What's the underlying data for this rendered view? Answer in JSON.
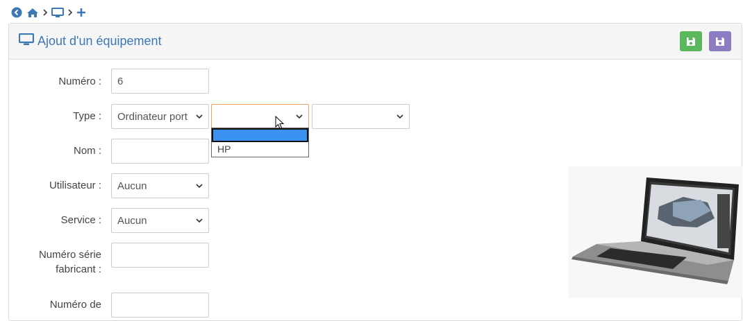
{
  "breadcrumb": {
    "items": [
      "back-icon",
      "home-icon",
      "monitor-icon",
      "plus-icon"
    ]
  },
  "panel": {
    "title": "Ajout d'un équipement",
    "icon": "monitor-icon"
  },
  "actions": {
    "save_icon": "save-icon",
    "save_close_icon": "save-icon",
    "colors": {
      "save": "#5cb85c",
      "save_close": "#8e7cc3"
    }
  },
  "form": {
    "numero": {
      "label": "Numéro :",
      "value": "6"
    },
    "type": {
      "label": "Type :",
      "type_value": "Ordinateur port",
      "brand_value": "",
      "model_value": ""
    },
    "brand_dropdown": {
      "options": [
        "",
        "HP"
      ],
      "selected_index": 0
    },
    "nom": {
      "label": "Nom :",
      "value": ""
    },
    "utilisateur": {
      "label": "Utilisateur :",
      "value": "Aucun"
    },
    "service": {
      "label": "Service :",
      "value": "Aucun"
    },
    "numero_serie_line1": "Numéro série",
    "numero_serie_line2": "fabricant :",
    "numero_serie_value": "",
    "numero_de_line1": "Numéro de",
    "numero_de_value": ""
  },
  "colors": {
    "accent": "#3c78b4",
    "focus": "#f0a160",
    "selection": "#3b91f0"
  }
}
